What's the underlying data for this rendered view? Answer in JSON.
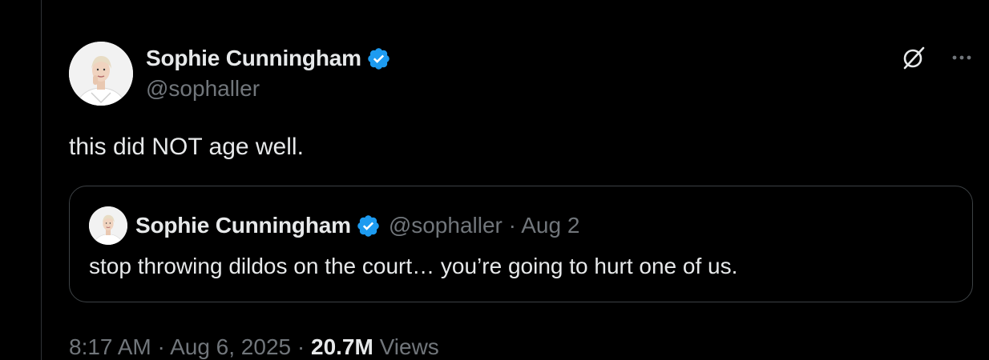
{
  "tweet": {
    "author": {
      "name": "Sophie Cunningham",
      "handle": "@sophaller",
      "verified": true
    },
    "text": "this did NOT age well.",
    "quote": {
      "name": "Sophie Cunningham",
      "handle": "@sophaller",
      "separator": "·",
      "date": "Aug 2",
      "text": "stop throwing dildos on the court… you’re going to hurt one of us."
    },
    "footer": {
      "time": "8:17 AM",
      "separator1": "·",
      "date": "Aug 6, 2025",
      "separator2": "·",
      "views_count": "20.7M",
      "views_label": "Views"
    }
  },
  "icons": {
    "verified": "verified-badge-icon",
    "grok": "grok-icon",
    "more": "more-icon"
  },
  "colors": {
    "background": "#000000",
    "primary_text": "#e7e9ea",
    "secondary_text": "#71767b",
    "verified_blue": "#1d9bf0",
    "border": "#2f3336"
  }
}
